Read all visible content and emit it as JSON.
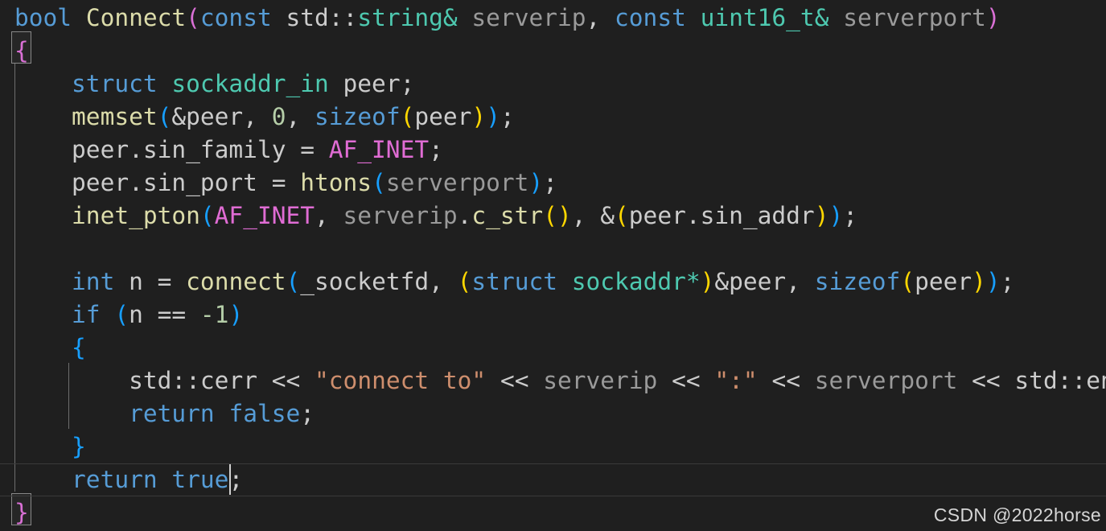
{
  "editor": {
    "background": "#1f1f1f",
    "language": "cpp",
    "caret": {
      "line": 14,
      "column": 16
    },
    "theme_colors": {
      "keyword": "#569cd6",
      "type": "#4ec9b0",
      "function": "#dcdcaa",
      "parameter": "#9a9a9a",
      "macro": "#e06cd4",
      "number": "#b5cea8",
      "string": "#ce8e6d",
      "plain": "#cccccc",
      "bracket_yellow": "#ffd700",
      "bracket_magenta": "#da70d6",
      "bracket_blue": "#179fff"
    }
  },
  "code": {
    "lines": [
      {
        "id": 1,
        "indent": 0,
        "current": false,
        "tokens": [
          {
            "t": "bool",
            "c": "kw"
          },
          {
            "t": " ",
            "c": "plain"
          },
          {
            "t": "Connect",
            "c": "fn"
          },
          {
            "t": "(",
            "c": "b1"
          },
          {
            "t": "const",
            "c": "kw"
          },
          {
            "t": " ",
            "c": "plain"
          },
          {
            "t": "std",
            "c": "plain"
          },
          {
            "t": "::",
            "c": "plain"
          },
          {
            "t": "string&",
            "c": "typ"
          },
          {
            "t": " ",
            "c": "plain"
          },
          {
            "t": "serverip",
            "c": "par"
          },
          {
            "t": ",",
            "c": "plain"
          },
          {
            "t": " ",
            "c": "plain"
          },
          {
            "t": "const",
            "c": "kw"
          },
          {
            "t": " ",
            "c": "plain"
          },
          {
            "t": "uint16_t&",
            "c": "typ"
          },
          {
            "t": " ",
            "c": "plain"
          },
          {
            "t": "serverport",
            "c": "par"
          },
          {
            "t": ")",
            "c": "b1"
          }
        ]
      },
      {
        "id": 2,
        "indent": 0,
        "current": false,
        "tokens": [
          {
            "t": "{",
            "c": "b1"
          }
        ]
      },
      {
        "id": 3,
        "indent": 1,
        "current": false,
        "tokens": [
          {
            "t": "struct",
            "c": "kw"
          },
          {
            "t": " ",
            "c": "plain"
          },
          {
            "t": "sockaddr_in",
            "c": "typ"
          },
          {
            "t": " ",
            "c": "plain"
          },
          {
            "t": "peer",
            "c": "plain"
          },
          {
            "t": ";",
            "c": "plain"
          }
        ]
      },
      {
        "id": 4,
        "indent": 1,
        "current": false,
        "tokens": [
          {
            "t": "memset",
            "c": "fn"
          },
          {
            "t": "(",
            "c": "b2"
          },
          {
            "t": "&peer",
            "c": "plain"
          },
          {
            "t": ", ",
            "c": "plain"
          },
          {
            "t": "0",
            "c": "num"
          },
          {
            "t": ", ",
            "c": "plain"
          },
          {
            "t": "sizeof",
            "c": "kw"
          },
          {
            "t": "(",
            "c": "b0"
          },
          {
            "t": "peer",
            "c": "plain"
          },
          {
            "t": ")",
            "c": "b0"
          },
          {
            "t": ")",
            "c": "b2"
          },
          {
            "t": ";",
            "c": "plain"
          }
        ]
      },
      {
        "id": 5,
        "indent": 1,
        "current": false,
        "tokens": [
          {
            "t": "peer",
            "c": "plain"
          },
          {
            "t": ".",
            "c": "plain"
          },
          {
            "t": "sin_family",
            "c": "plain"
          },
          {
            "t": " = ",
            "c": "plain"
          },
          {
            "t": "AF_INET",
            "c": "mac"
          },
          {
            "t": ";",
            "c": "plain"
          }
        ]
      },
      {
        "id": 6,
        "indent": 1,
        "current": false,
        "tokens": [
          {
            "t": "peer",
            "c": "plain"
          },
          {
            "t": ".",
            "c": "plain"
          },
          {
            "t": "sin_port",
            "c": "plain"
          },
          {
            "t": " = ",
            "c": "plain"
          },
          {
            "t": "htons",
            "c": "fn"
          },
          {
            "t": "(",
            "c": "b2"
          },
          {
            "t": "serverport",
            "c": "par"
          },
          {
            "t": ")",
            "c": "b2"
          },
          {
            "t": ";",
            "c": "plain"
          }
        ]
      },
      {
        "id": 7,
        "indent": 1,
        "current": false,
        "tokens": [
          {
            "t": "inet_pton",
            "c": "fn"
          },
          {
            "t": "(",
            "c": "b2"
          },
          {
            "t": "AF_INET",
            "c": "mac"
          },
          {
            "t": ", ",
            "c": "plain"
          },
          {
            "t": "serverip",
            "c": "par"
          },
          {
            "t": ".",
            "c": "plain"
          },
          {
            "t": "c_str",
            "c": "fn"
          },
          {
            "t": "(",
            "c": "b0"
          },
          {
            "t": ")",
            "c": "b0"
          },
          {
            "t": ", ",
            "c": "plain"
          },
          {
            "t": "&",
            "c": "plain"
          },
          {
            "t": "(",
            "c": "b0"
          },
          {
            "t": "peer",
            "c": "plain"
          },
          {
            "t": ".",
            "c": "plain"
          },
          {
            "t": "sin_addr",
            "c": "plain"
          },
          {
            "t": ")",
            "c": "b0"
          },
          {
            "t": ")",
            "c": "b2"
          },
          {
            "t": ";",
            "c": "plain"
          }
        ]
      },
      {
        "id": 8,
        "indent": 1,
        "current": false,
        "tokens": []
      },
      {
        "id": 9,
        "indent": 1,
        "current": false,
        "tokens": [
          {
            "t": "int",
            "c": "kw"
          },
          {
            "t": " ",
            "c": "plain"
          },
          {
            "t": "n",
            "c": "plain"
          },
          {
            "t": " = ",
            "c": "plain"
          },
          {
            "t": "connect",
            "c": "fn"
          },
          {
            "t": "(",
            "c": "b2"
          },
          {
            "t": "_socketfd",
            "c": "plain"
          },
          {
            "t": ", ",
            "c": "plain"
          },
          {
            "t": "(",
            "c": "b0"
          },
          {
            "t": "struct",
            "c": "kw"
          },
          {
            "t": " ",
            "c": "plain"
          },
          {
            "t": "sockaddr*",
            "c": "typ"
          },
          {
            "t": ")",
            "c": "b0"
          },
          {
            "t": "&peer",
            "c": "plain"
          },
          {
            "t": ", ",
            "c": "plain"
          },
          {
            "t": "sizeof",
            "c": "kw"
          },
          {
            "t": "(",
            "c": "b0"
          },
          {
            "t": "peer",
            "c": "plain"
          },
          {
            "t": ")",
            "c": "b0"
          },
          {
            "t": ")",
            "c": "b2"
          },
          {
            "t": ";",
            "c": "plain"
          }
        ]
      },
      {
        "id": 10,
        "indent": 1,
        "current": false,
        "tokens": [
          {
            "t": "if",
            "c": "kw"
          },
          {
            "t": " ",
            "c": "plain"
          },
          {
            "t": "(",
            "c": "b2"
          },
          {
            "t": "n",
            "c": "plain"
          },
          {
            "t": " == ",
            "c": "plain"
          },
          {
            "t": "-1",
            "c": "num"
          },
          {
            "t": ")",
            "c": "b2"
          }
        ]
      },
      {
        "id": 11,
        "indent": 1,
        "current": false,
        "tokens": [
          {
            "t": "{",
            "c": "b2"
          }
        ]
      },
      {
        "id": 12,
        "indent": 2,
        "current": false,
        "tokens": [
          {
            "t": "std",
            "c": "plain"
          },
          {
            "t": "::",
            "c": "plain"
          },
          {
            "t": "cerr",
            "c": "plain"
          },
          {
            "t": " ",
            "c": "plain"
          },
          {
            "t": "<<",
            "c": "plain"
          },
          {
            "t": " ",
            "c": "plain"
          },
          {
            "t": "\"connect to\"",
            "c": "str"
          },
          {
            "t": " ",
            "c": "plain"
          },
          {
            "t": "<<",
            "c": "plain"
          },
          {
            "t": " ",
            "c": "plain"
          },
          {
            "t": "serverip",
            "c": "par"
          },
          {
            "t": " ",
            "c": "plain"
          },
          {
            "t": "<<",
            "c": "plain"
          },
          {
            "t": " ",
            "c": "plain"
          },
          {
            "t": "\":\"",
            "c": "str"
          },
          {
            "t": " ",
            "c": "plain"
          },
          {
            "t": "<<",
            "c": "plain"
          },
          {
            "t": " ",
            "c": "plain"
          },
          {
            "t": "serverport",
            "c": "par"
          },
          {
            "t": " ",
            "c": "plain"
          },
          {
            "t": "<<",
            "c": "plain"
          },
          {
            "t": " ",
            "c": "plain"
          },
          {
            "t": "std",
            "c": "plain"
          },
          {
            "t": "::",
            "c": "plain"
          },
          {
            "t": "endl",
            "c": "plain"
          },
          {
            "t": ";",
            "c": "plain"
          }
        ]
      },
      {
        "id": 13,
        "indent": 2,
        "current": false,
        "tokens": [
          {
            "t": "return",
            "c": "kw"
          },
          {
            "t": " ",
            "c": "plain"
          },
          {
            "t": "false",
            "c": "kw"
          },
          {
            "t": ";",
            "c": "plain"
          }
        ]
      },
      {
        "id": 14,
        "indent": 1,
        "current": false,
        "tokens": [
          {
            "t": "}",
            "c": "b2"
          }
        ]
      },
      {
        "id": 15,
        "indent": 1,
        "current": true,
        "tokens": [
          {
            "t": "return",
            "c": "kw"
          },
          {
            "t": " ",
            "c": "plain"
          },
          {
            "t": "true",
            "c": "kw"
          },
          {
            "t": ";",
            "c": "plain"
          }
        ]
      },
      {
        "id": 16,
        "indent": 0,
        "current": false,
        "tokens": [
          {
            "t": "}",
            "c": "b1"
          }
        ]
      }
    ]
  },
  "watermark": {
    "text": "CSDN @2022horse"
  }
}
